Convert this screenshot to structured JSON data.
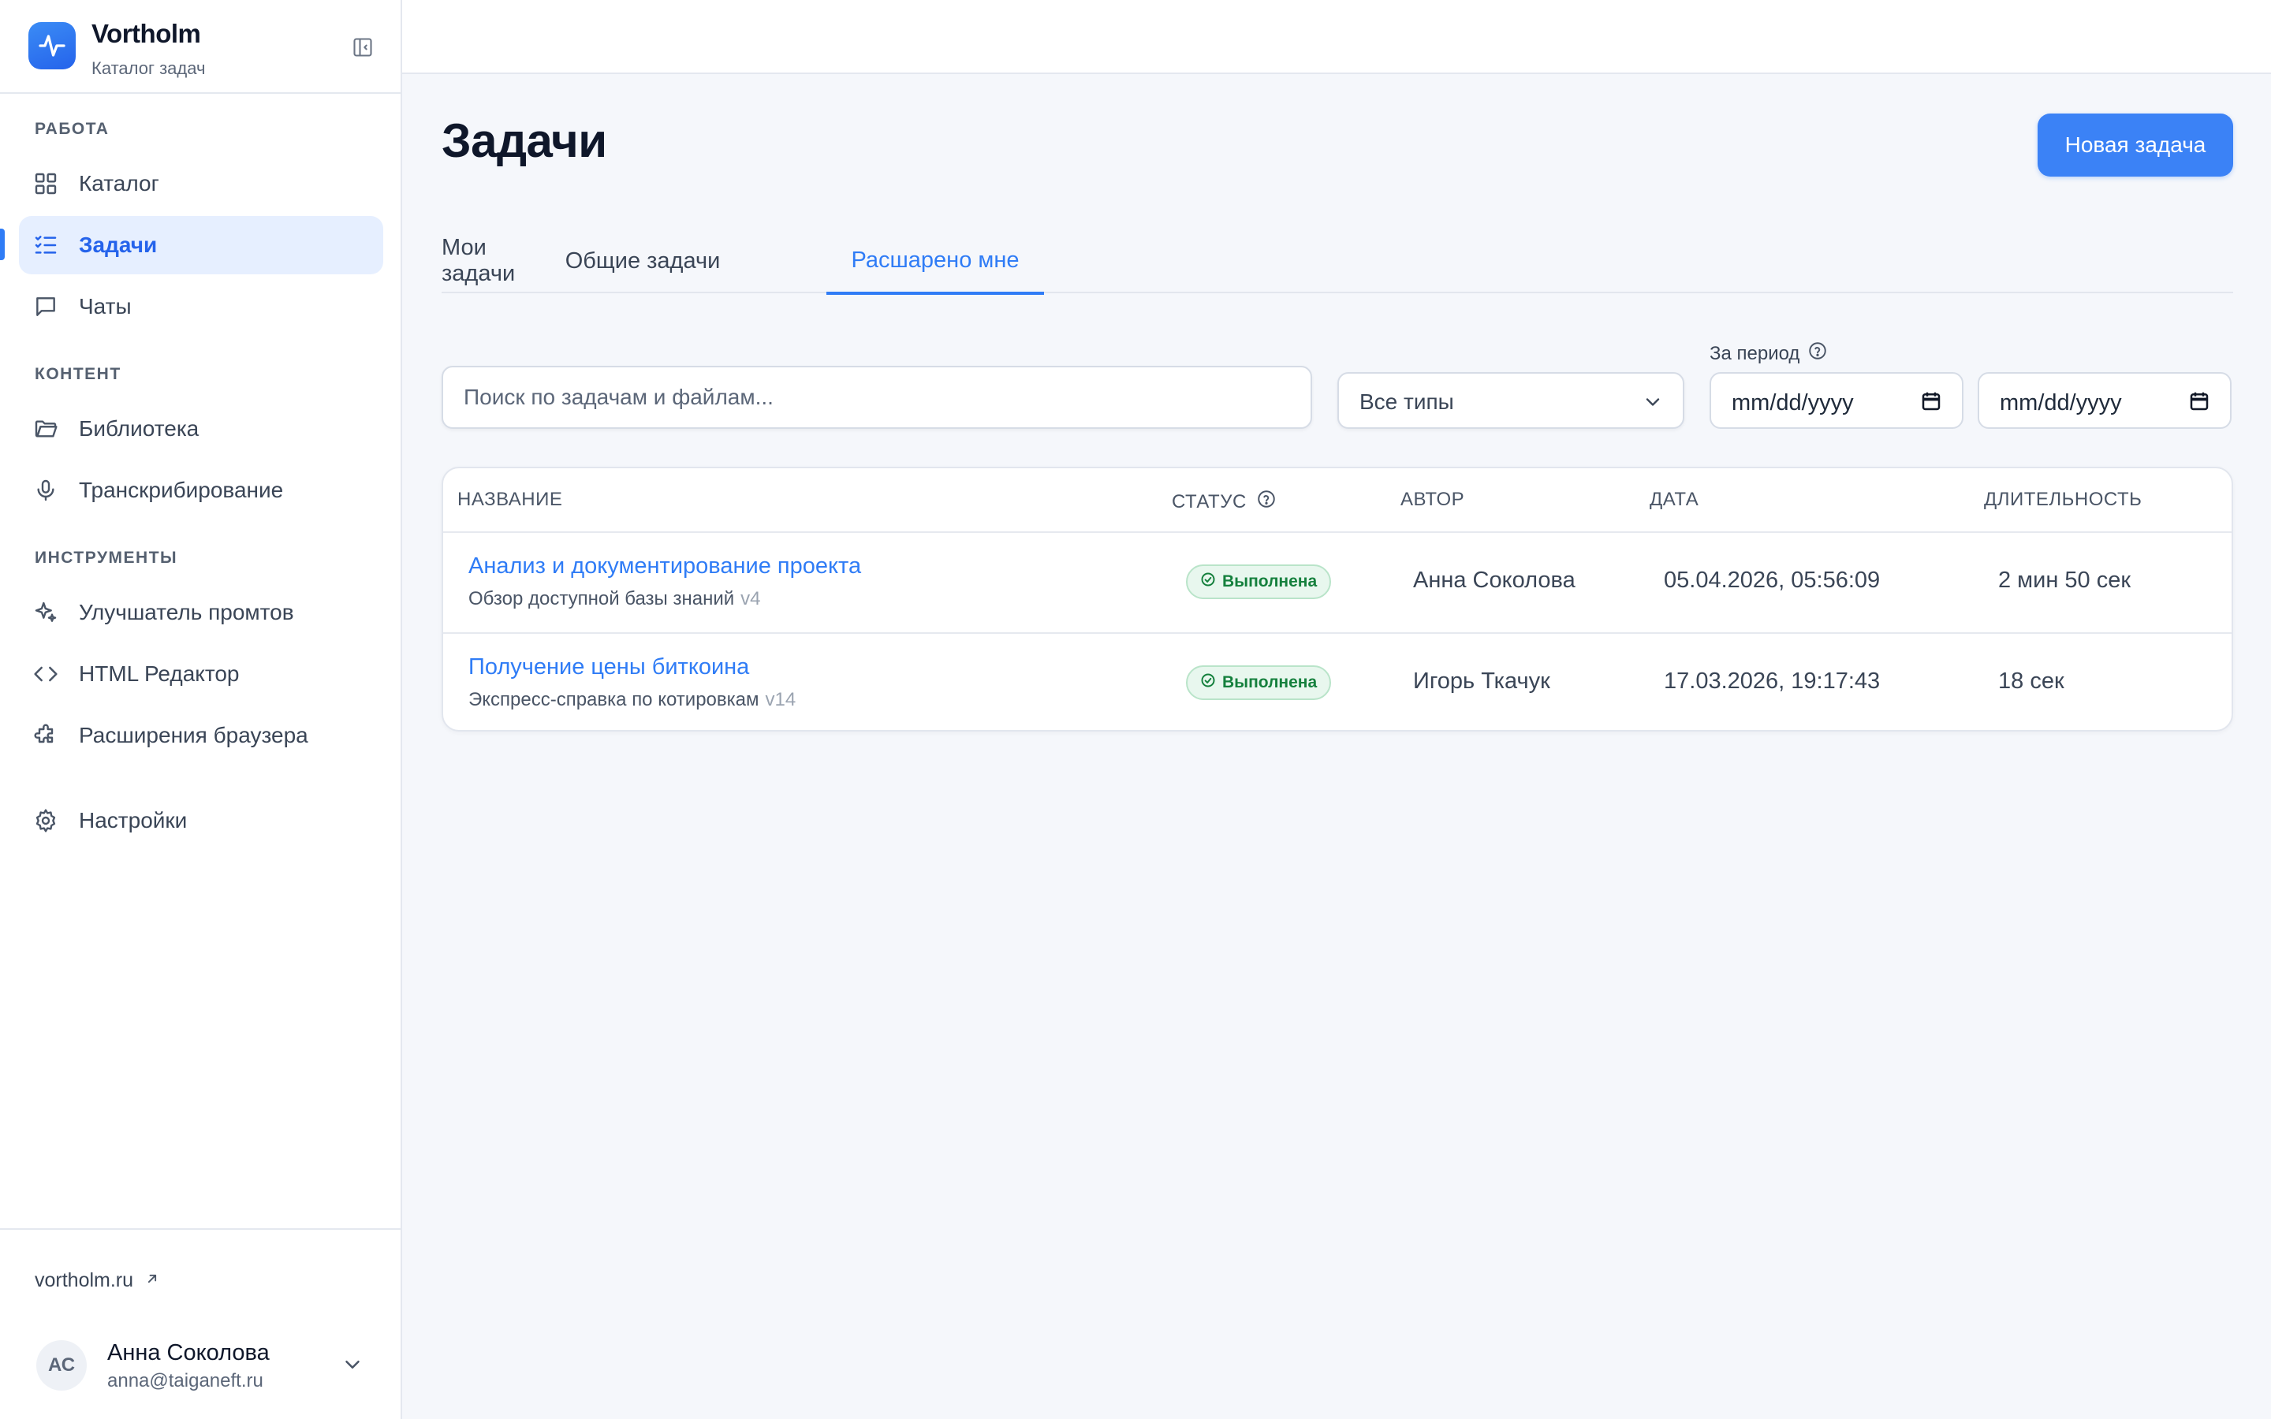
{
  "brand": {
    "name": "Vortholm",
    "subtitle": "Каталог задач"
  },
  "sidebar": {
    "sections": [
      {
        "title": "РАБОТА"
      },
      {
        "title": "КОНТЕНТ"
      },
      {
        "title": "ИНСТРУМЕНТЫ"
      }
    ],
    "items": [
      {
        "label": "Каталог",
        "icon": "grid-icon"
      },
      {
        "label": "Задачи",
        "icon": "task-list-icon",
        "active": true
      },
      {
        "label": "Чаты",
        "icon": "chat-icon"
      },
      {
        "label": "Библиотека",
        "icon": "folder-icon"
      },
      {
        "label": "Транскрибирование",
        "icon": "microphone-icon"
      },
      {
        "label": "Улучшатель промтов",
        "icon": "sparkles-icon"
      },
      {
        "label": "HTML Редактор",
        "icon": "code-icon"
      },
      {
        "label": "Расширения браузера",
        "icon": "puzzle-icon"
      },
      {
        "label": "Настройки",
        "icon": "gear-icon"
      }
    ],
    "footer": {
      "site_link": "vortholm.ru",
      "user": {
        "initials": "АС",
        "name": "Анна Соколова",
        "email": "anna@taiganeft.ru"
      }
    }
  },
  "main": {
    "title": "Задачи",
    "new_task_label": "Новая задача",
    "tabs": [
      {
        "label": "Мои задачи"
      },
      {
        "label": "Общие задачи"
      },
      {
        "label": "Расшарено мне",
        "active": true
      }
    ],
    "filters": {
      "search_placeholder": "Поиск по задачам и файлам...",
      "type_value": "Все типы",
      "period_label": "За период",
      "date_from": "mm/dd/yyyy",
      "date_to": "mm/dd/yyyy"
    },
    "table": {
      "columns": [
        "НАЗВАНИЕ",
        "СТАТУС",
        "АВТОР",
        "ДАТА",
        "ДЛИТЕЛЬНОСТЬ"
      ],
      "rows": [
        {
          "title": "Анализ и документирование проекта",
          "subtitle": "Обзор доступной базы знаний",
          "version": "v4",
          "status": "Выполнена",
          "author": "Анна Соколова",
          "date": "05.04.2026, 05:56:09",
          "duration": "2 мин 50 сек"
        },
        {
          "title": "Получение цены биткоина",
          "subtitle": "Экспресс-справка по котировкам",
          "version": "v14",
          "status": "Выполнена",
          "author": "Игорь Ткачук",
          "date": "17.03.2026, 19:17:43",
          "duration": "18 сек"
        }
      ]
    }
  },
  "colors": {
    "accent": "#3b82f6",
    "success": "#15803d",
    "success_bg": "#e8f7ee"
  }
}
